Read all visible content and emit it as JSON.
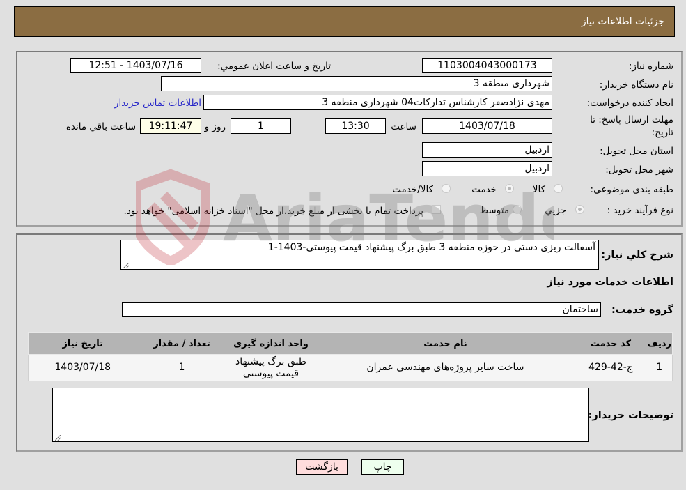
{
  "header": {
    "title": "جزئیات اطلاعات نیاز"
  },
  "info": {
    "need_number_label": "شماره نیاز:",
    "need_number": "1103004043000173",
    "announce_label": "تاریخ و ساعت اعلان عمومي:",
    "announce_value": "1403/07/16 - 12:51",
    "buyer_org_label": "نام دستگاه خریدار:",
    "buyer_org": "شهرداری منطقه 3",
    "creator_label": "ایجاد کننده درخواست:",
    "creator": "مهدی نژادصفر کارشناس تدارکات04 شهرداری منطقه 3",
    "contact_link": "اطلاعات تماس خریدار",
    "deadline_label_1": "مهلت ارسال پاسخ: تا",
    "deadline_label_2": "تاریخ:",
    "deadline_date": "1403/07/18",
    "time_label": "ساعت",
    "deadline_time": "13:30",
    "days_value": "1",
    "days_label": "روز و",
    "remaining_time": "19:11:47",
    "remaining_label": "ساعت باقي مانده",
    "province_label": "استان محل تحویل:",
    "province": "اردبیل",
    "city_label": "شهر محل تحویل:",
    "city": "اردبیل",
    "category_label": "طبقه بندی موضوعی:",
    "category_options": [
      {
        "label": "کالا",
        "selected": false
      },
      {
        "label": "خدمت",
        "selected": true
      },
      {
        "label": "کالا/خدمت",
        "selected": false
      }
    ],
    "process_label": "نوع فرآیند خرید :",
    "process_options": [
      {
        "label": "جزيي",
        "selected": true
      },
      {
        "label": "متوسط",
        "selected": false
      }
    ],
    "treasury_note": "پرداخت تمام یا بخشی از مبلغ خرید،از محل \"اسناد خزانه اسلامی\" خواهد بود."
  },
  "details": {
    "description_label": "شرح کلي نياز:",
    "description": "آسفالت ریزی دستی در حوزه منطقه 3 طبق برگ پیشنهاد قیمت پیوستی-1403-1",
    "services_heading": "اطلاعات خدمات مورد نیاز",
    "service_group_label": "گروه خدمت:",
    "service_group": "ساختمان",
    "table": {
      "headers": [
        "ردیف",
        "کد خدمت",
        "نام خدمت",
        "واحد اندازه گیری",
        "تعداد / مقدار",
        "تاریخ نیاز"
      ],
      "rows": [
        [
          "1",
          "ج-42-429",
          "ساخت سایر پروژه‌های مهندسی عمران",
          "طبق برگ پیشنهاد قیمت پیوستی",
          "1",
          "1403/07/18"
        ]
      ]
    },
    "buyer_notes_label": "توضیحات خریدار:",
    "buyer_notes": ""
  },
  "buttons": {
    "print": "چاپ",
    "back": "بازگشت"
  },
  "watermark": {
    "text": "AriaTender.neT"
  }
}
